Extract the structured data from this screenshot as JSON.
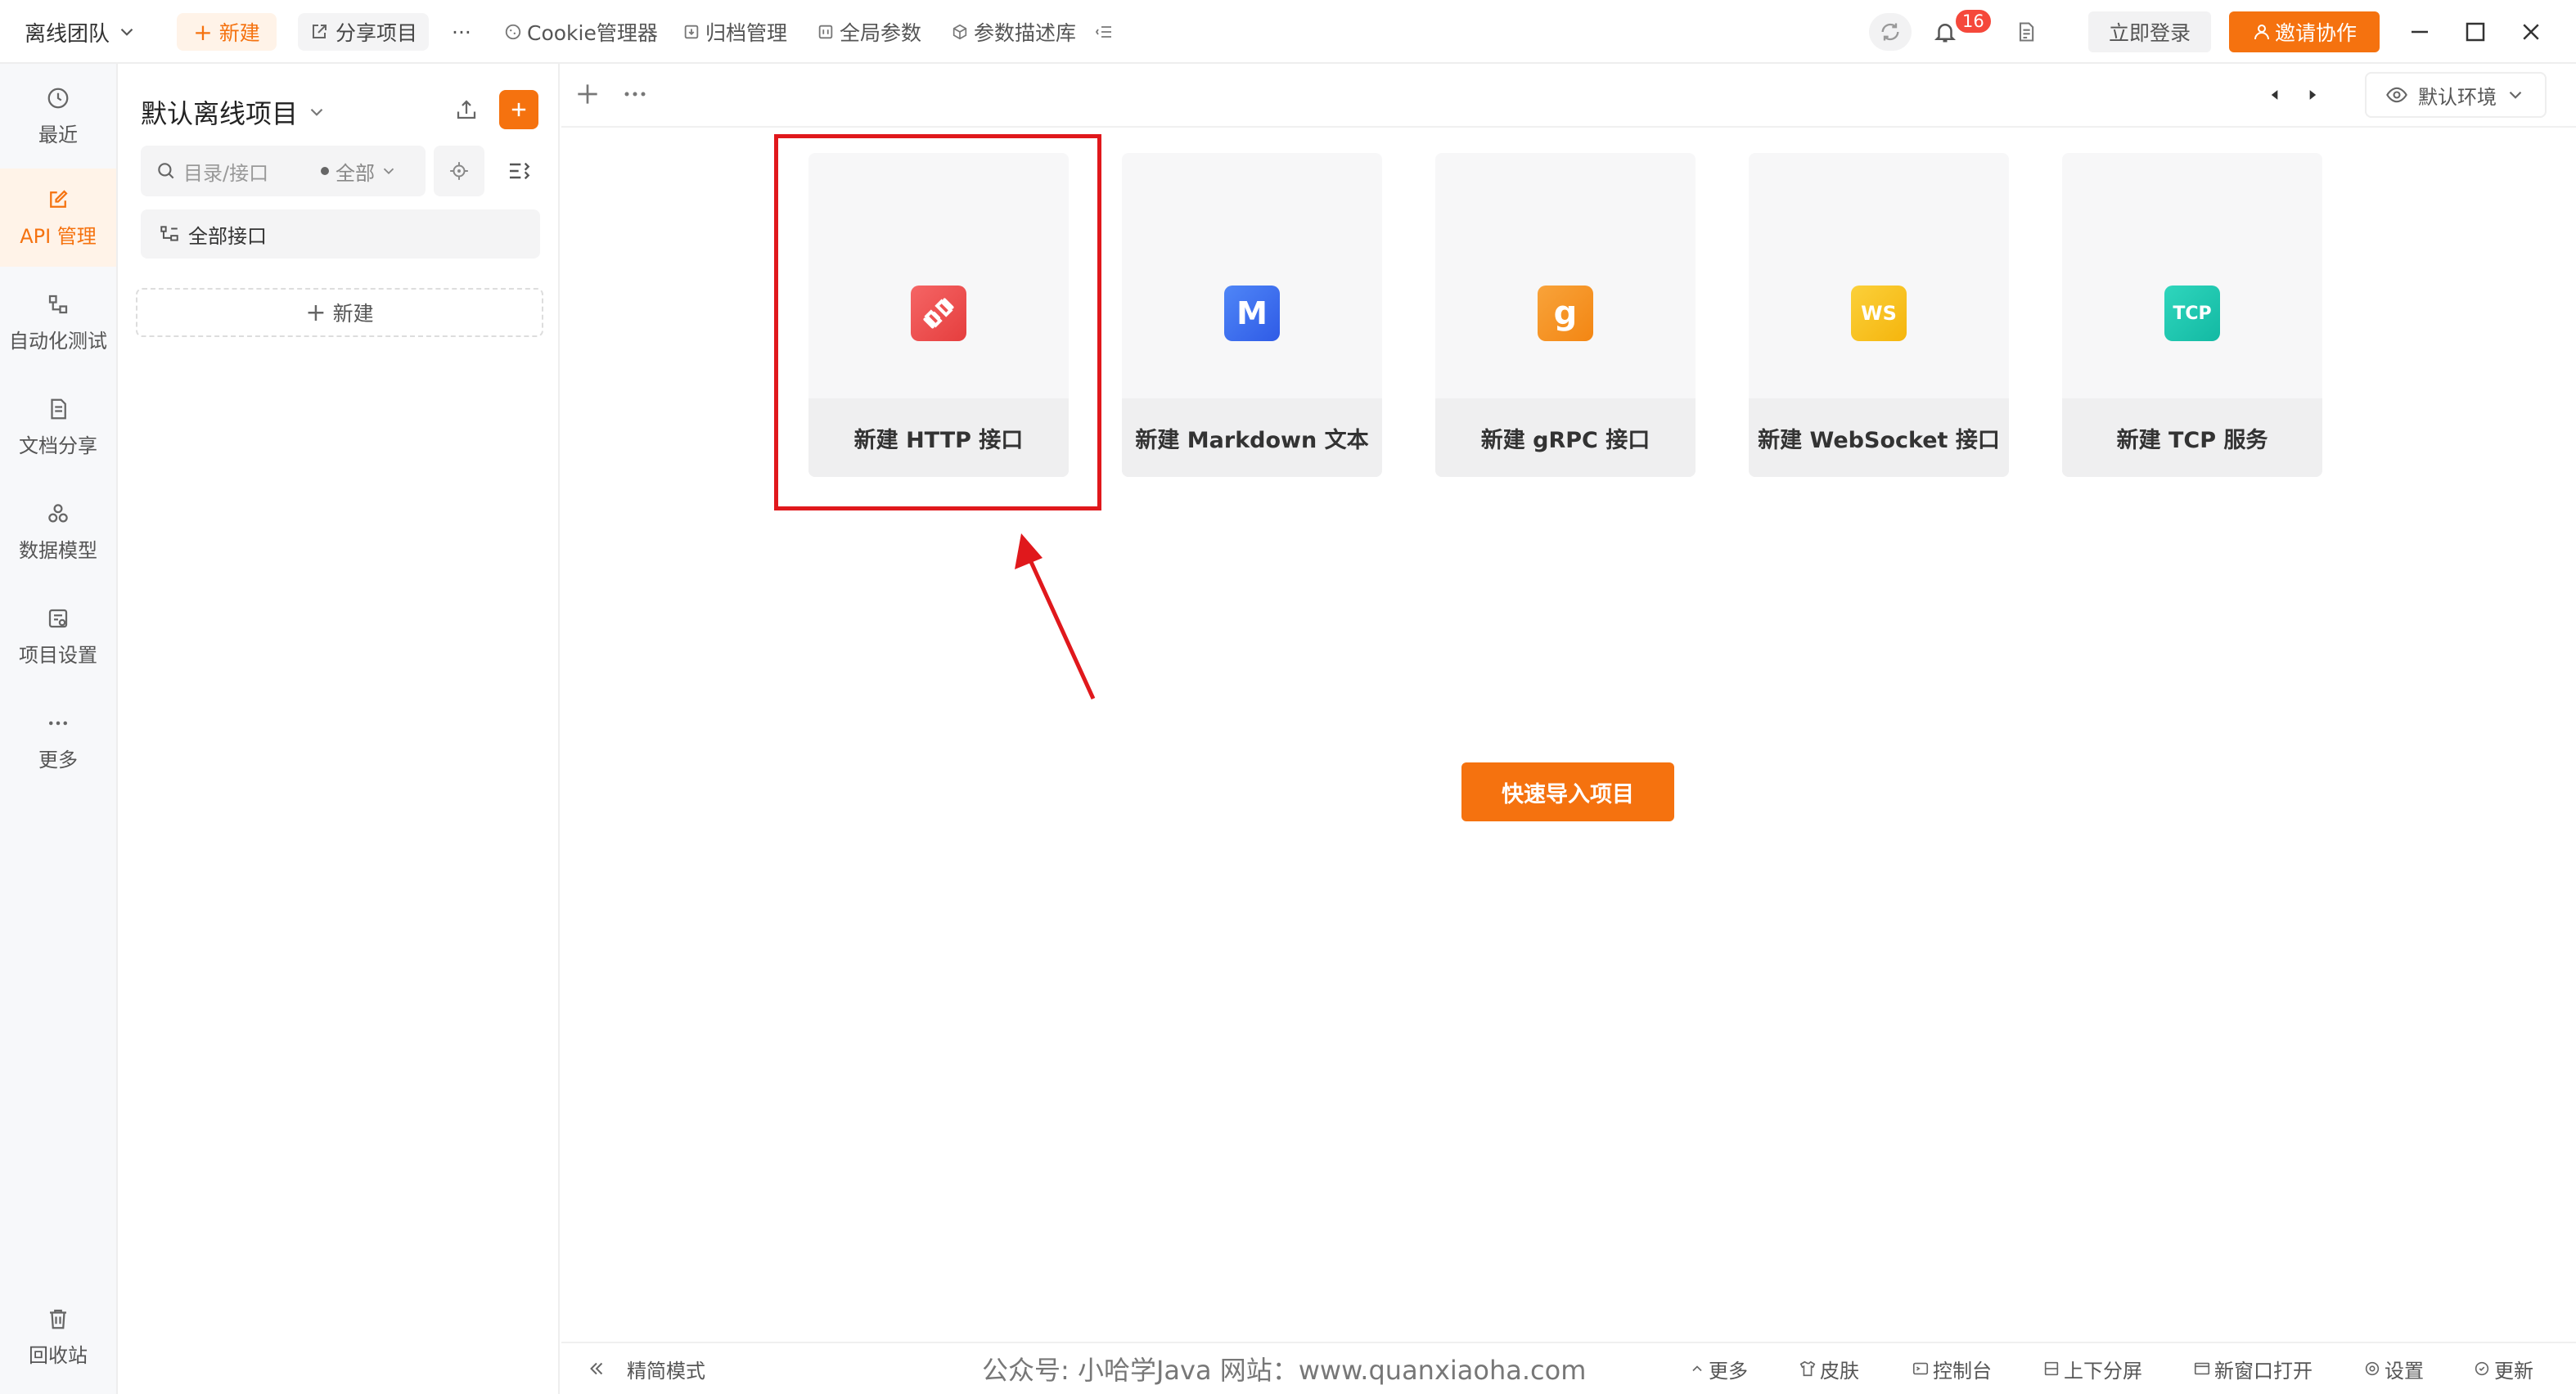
{
  "topbar": {
    "team": "离线团队",
    "new_label": "新建",
    "share_label": "分享项目",
    "more": "···",
    "menu": [
      "Cookie管理器",
      "归档管理",
      "全局参数",
      "参数描述库"
    ],
    "notification_count": "16",
    "login_label": "立即登录",
    "invite_label": "邀请协作"
  },
  "leftnav": {
    "items": [
      "最近",
      "API 管理",
      "自动化测试",
      "文档分享",
      "数据模型",
      "项目设置",
      "更多"
    ],
    "recycle": "回收站"
  },
  "sidebar": {
    "project_name": "默认离线项目",
    "search_placeholder": "目录/接口",
    "filter_label": "全部",
    "all_api_label": "全部接口",
    "new_label": "新建"
  },
  "main": {
    "env_label": "默认环境",
    "cards": [
      {
        "label": "新建 HTTP 接口",
        "icon": "http-plug-icon",
        "color": "#f04848"
      },
      {
        "label": "新建 Markdown 文本",
        "icon": "markdown-icon",
        "color": "#3b6ef6"
      },
      {
        "label": "新建 gRPC 接口",
        "icon": "grpc-icon",
        "color": "#f5901e"
      },
      {
        "label": "新建 WebSocket 接口",
        "icon": "websocket-icon",
        "color": "#f7c020"
      },
      {
        "label": "新建 TCP 服务",
        "icon": "tcp-icon",
        "color": "#1cc7b0"
      }
    ],
    "markdown_glyph": "M",
    "grpc_glyph": "g",
    "ws_glyph": "WS",
    "tcp_glyph": "TCP",
    "import_label": "快速导入项目"
  },
  "statusbar": {
    "simple_mode": "精简模式",
    "watermark": "公众号: 小哈学Java  网站：www.quanxiaoha.com",
    "items": [
      "更多",
      "皮肤",
      "控制台",
      "上下分屏",
      "新窗口打开",
      "设置",
      "更新"
    ]
  },
  "colors": {
    "accent": "#f5720f",
    "highlight": "#e0181c"
  }
}
